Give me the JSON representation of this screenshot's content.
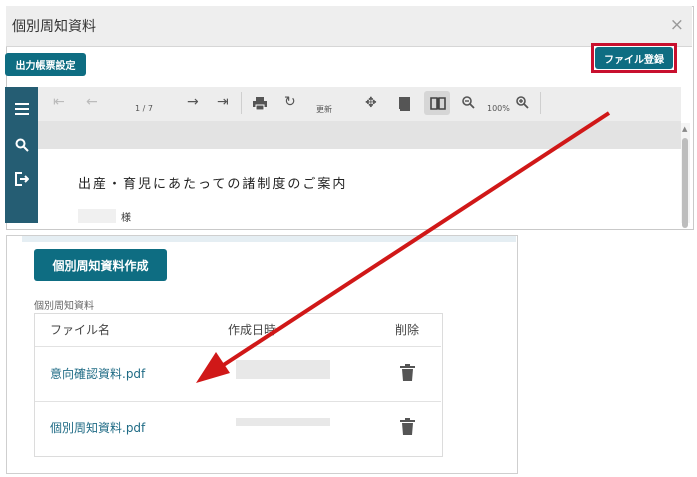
{
  "dialog": {
    "title": "個別周知資料",
    "close_glyph": "×",
    "output_button": "出力帳票設定",
    "register_button": "ファイル登録"
  },
  "toolbar": {
    "page": "1 / 7",
    "refresh_label": "更新",
    "zoom": "100%"
  },
  "document": {
    "title": "出産・育児にあたっての諸制度のご案内",
    "honorific": "様"
  },
  "panel": {
    "create_button": "個別周知資料作成",
    "section_label": "個別周知資料",
    "columns": [
      "ファイル名",
      "作成日時",
      "削除"
    ],
    "files": [
      {
        "name": "意向確認資料.pdf"
      },
      {
        "name": "個別周知資料.pdf"
      }
    ]
  },
  "colors": {
    "accent": "#0e6d82",
    "sidebar": "#255d73",
    "highlight_border": "#c8102e",
    "arrow": "#d01818",
    "link": "#1f6b85"
  }
}
